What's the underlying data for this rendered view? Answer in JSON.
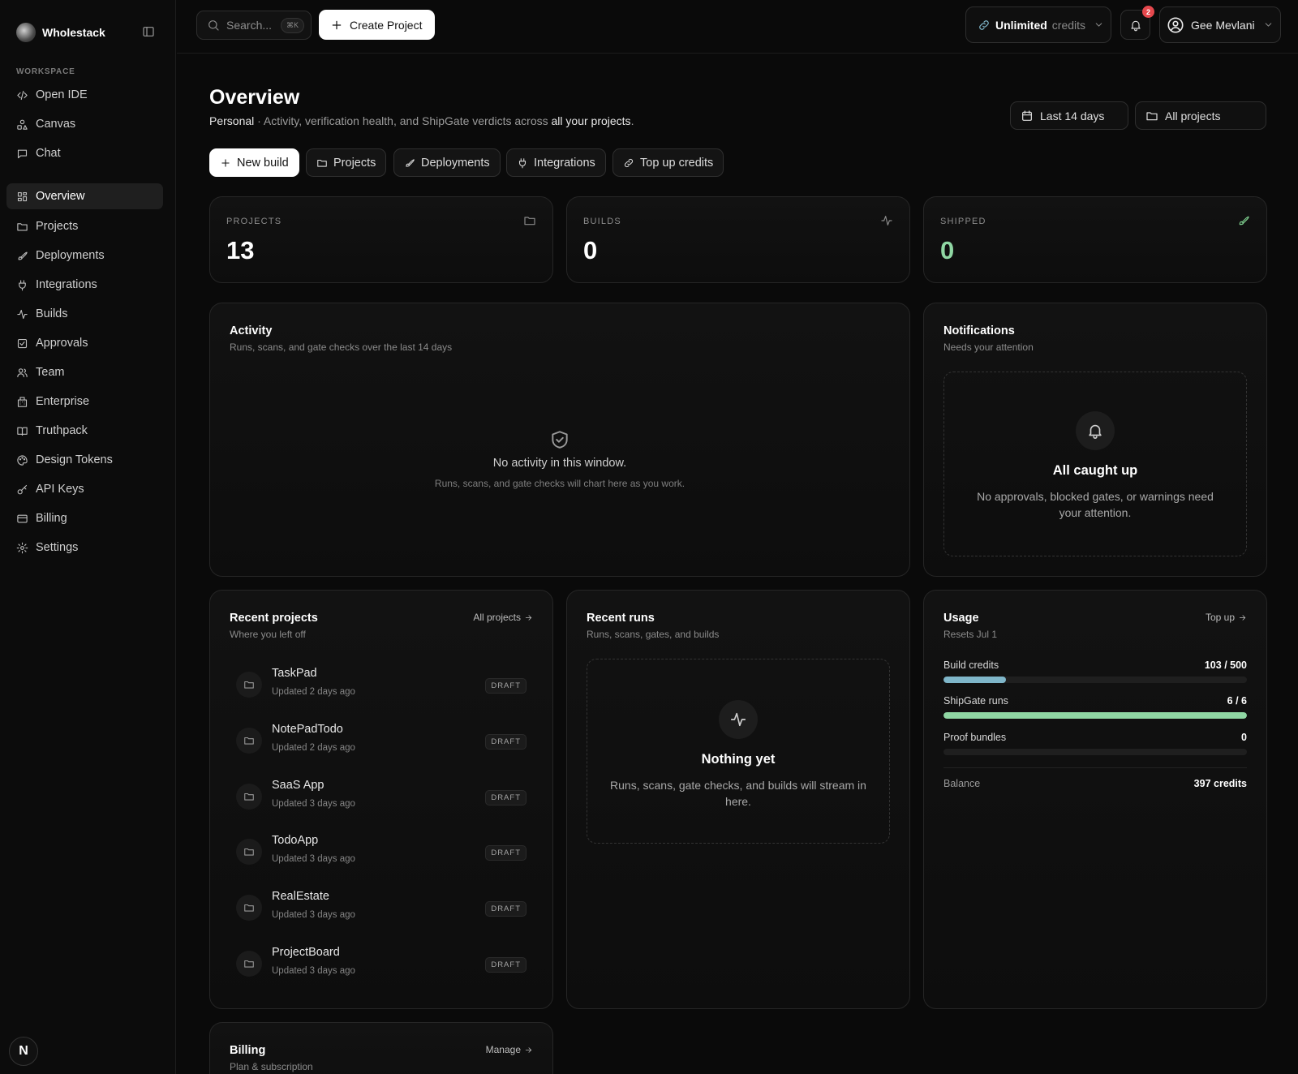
{
  "app": {
    "name": "Wholestack"
  },
  "sidebar": {
    "section_label": "WORKSPACE",
    "workspace_items": [
      {
        "label": "Open IDE",
        "icon": "code-icon"
      },
      {
        "label": "Canvas",
        "icon": "shapes-icon"
      },
      {
        "label": "Chat",
        "icon": "chat-icon"
      }
    ],
    "items": [
      {
        "label": "Overview",
        "icon": "grid-icon",
        "active": true
      },
      {
        "label": "Projects",
        "icon": "folder-icon"
      },
      {
        "label": "Deployments",
        "icon": "rocket-icon"
      },
      {
        "label": "Integrations",
        "icon": "plug-icon"
      },
      {
        "label": "Builds",
        "icon": "activity-icon"
      },
      {
        "label": "Approvals",
        "icon": "check-square-icon"
      },
      {
        "label": "Team",
        "icon": "users-icon"
      },
      {
        "label": "Enterprise",
        "icon": "building-icon"
      },
      {
        "label": "Truthpack",
        "icon": "book-icon"
      },
      {
        "label": "Design Tokens",
        "icon": "palette-icon"
      },
      {
        "label": "API Keys",
        "icon": "key-icon"
      },
      {
        "label": "Billing",
        "icon": "credit-card-icon"
      },
      {
        "label": "Settings",
        "icon": "gear-icon"
      }
    ],
    "footer_badge": "N"
  },
  "topbar": {
    "search_placeholder": "Search...",
    "search_shortcut": "⌘K",
    "create_label": "Create Project",
    "credits_strong": "Unlimited",
    "credits_muted": "credits",
    "notification_count": "2",
    "user_name": "Gee Mevlani"
  },
  "overview": {
    "title": "Overview",
    "scope": "Personal",
    "sub_middle": " · Activity, verification health, and ShipGate verdicts across ",
    "sub_strong": "all your projects",
    "sub_end": ".",
    "date_filter": "Last 14 days",
    "project_filter": "All projects",
    "quick_actions": [
      {
        "label": "New build",
        "icon": "plus-icon"
      },
      {
        "label": "Projects",
        "icon": "folder-icon"
      },
      {
        "label": "Deployments",
        "icon": "rocket-icon"
      },
      {
        "label": "Integrations",
        "icon": "plug-icon"
      },
      {
        "label": "Top up credits",
        "icon": "link-icon"
      }
    ]
  },
  "stats": [
    {
      "label": "PROJECTS",
      "value": "13",
      "icon": "folder-icon"
    },
    {
      "label": "BUILDS",
      "value": "0",
      "icon": "activity-icon"
    },
    {
      "label": "SHIPPED",
      "value": "0",
      "icon": "rocket-icon",
      "accent": "#8fd7a3"
    }
  ],
  "activity": {
    "title": "Activity",
    "subtitle": "Runs, scans, and gate checks over the last 14 days",
    "empty_title": "No activity in this window.",
    "empty_sub": "Runs, scans, and gate checks will chart here as you work."
  },
  "notifications": {
    "title": "Notifications",
    "subtitle": "Needs your attention",
    "empty_title": "All caught up",
    "empty_sub": "No approvals, blocked gates, or warnings need your attention."
  },
  "recent_projects": {
    "title": "Recent projects",
    "subtitle": "Where you left off",
    "link": "All projects",
    "items": [
      {
        "name": "TaskPad",
        "updated": "Updated 2 days ago",
        "status": "DRAFT"
      },
      {
        "name": "NotePadTodo",
        "updated": "Updated 2 days ago",
        "status": "DRAFT"
      },
      {
        "name": "SaaS App",
        "updated": "Updated 3 days ago",
        "status": "DRAFT"
      },
      {
        "name": "TodoApp",
        "updated": "Updated 3 days ago",
        "status": "DRAFT"
      },
      {
        "name": "RealEstate",
        "updated": "Updated 3 days ago",
        "status": "DRAFT"
      },
      {
        "name": "ProjectBoard",
        "updated": "Updated 3 days ago",
        "status": "DRAFT"
      }
    ]
  },
  "recent_runs": {
    "title": "Recent runs",
    "subtitle": "Runs, scans, gates, and builds",
    "empty_title": "Nothing yet",
    "empty_sub": "Runs, scans, gate checks, and builds will stream in here."
  },
  "usage": {
    "title": "Usage",
    "subtitle": "Resets Jul 1",
    "link": "Top up",
    "rows": [
      {
        "label": "Build credits",
        "value": "103 / 500",
        "used": 103,
        "total": 500,
        "color": "#7fb6c9"
      },
      {
        "label": "ShipGate runs",
        "value": "6 / 6",
        "used": 6,
        "total": 6,
        "color": "#8fd7a3"
      },
      {
        "label": "Proof bundles",
        "value": "0",
        "used": 0,
        "total": 1,
        "color": "#8fd7a3"
      }
    ],
    "balance_label": "Balance",
    "balance_value": "397 credits"
  },
  "billing": {
    "title": "Billing",
    "subtitle": "Plan & subscription",
    "link": "Manage"
  }
}
